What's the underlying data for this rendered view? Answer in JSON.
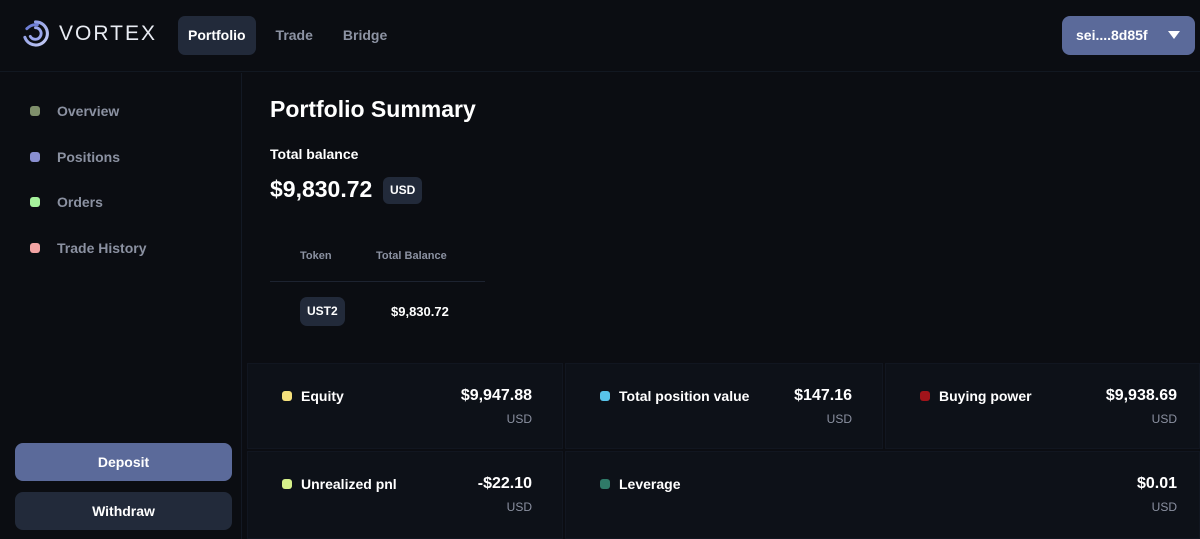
{
  "app": {
    "name": "VORTEX"
  },
  "nav": {
    "items": [
      {
        "label": "Portfolio",
        "active": true
      },
      {
        "label": "Trade",
        "active": false
      },
      {
        "label": "Bridge",
        "active": false
      }
    ]
  },
  "wallet": {
    "address": "sei....8d85f"
  },
  "sidebar": {
    "items": [
      {
        "label": "Overview",
        "color": "#7f8f6b"
      },
      {
        "label": "Positions",
        "color": "#8a8fd1"
      },
      {
        "label": "Orders",
        "color": "#a6f29c"
      },
      {
        "label": "Trade History",
        "color": "#f2a3a3"
      }
    ],
    "deposit_label": "Deposit",
    "withdraw_label": "Withdraw"
  },
  "summary": {
    "title": "Portfolio Summary",
    "balance_label": "Total balance",
    "balance_value": "$9,830.72",
    "balance_unit": "USD"
  },
  "token_table": {
    "headers": [
      "Token",
      "Total Balance"
    ],
    "rows": [
      {
        "token": "UST2",
        "balance": "$9,830.72"
      }
    ]
  },
  "metrics": [
    {
      "label": "Equity",
      "value": "$9,947.88",
      "unit": "USD",
      "color": "#f4e07c"
    },
    {
      "label": "Total position value",
      "value": "$147.16",
      "unit": "USD",
      "color": "#58c4ea"
    },
    {
      "label": "Buying power",
      "value": "$9,938.69",
      "unit": "USD",
      "color": "#a0141a"
    },
    {
      "label": "Unrealized pnl",
      "value": "-$22.10",
      "unit": "USD",
      "color": "#d5f08a"
    },
    {
      "label": "Leverage",
      "value": "$0.01",
      "unit": "USD",
      "color": "#2f7a68"
    }
  ]
}
